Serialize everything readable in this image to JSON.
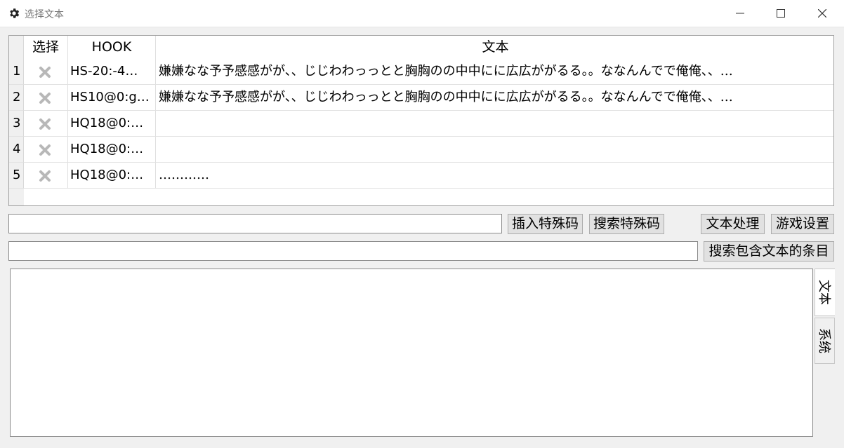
{
  "window": {
    "title": "选择文本",
    "icon": "gear-icon"
  },
  "table": {
    "headers": {
      "select": "选择",
      "hook": "HOOK",
      "text": "文本"
    },
    "rows": [
      {
        "num": "1",
        "hook": "HS-20:-4…",
        "text": "嫌嫌なな予予感感がが、、じじわわっっとと胸胸のの中中にに広広ががるる。。ななんんでで俺俺、、…"
      },
      {
        "num": "2",
        "hook": "HS10@0:g…",
        "text": "嫌嫌なな予予感感がが、、じじわわっっとと胸胸のの中中にに広広ががるる。。ななんんでで俺俺、、…"
      },
      {
        "num": "3",
        "hook": "HQ18@0:…",
        "text": ""
      },
      {
        "num": "4",
        "hook": "HQ18@0:…",
        "text": ""
      },
      {
        "num": "5",
        "hook": "HQ18@0:…",
        "text": "…………"
      }
    ]
  },
  "toolbar": {
    "insert_code": "插入特殊码",
    "search_code": "搜索特殊码",
    "text_process": "文本处理",
    "game_settings": "游戏设置",
    "search_text": "搜索包含文本的条目",
    "code_input_value": "",
    "search_input_value": ""
  },
  "tabs": {
    "text": "文本",
    "system": "系统"
  }
}
